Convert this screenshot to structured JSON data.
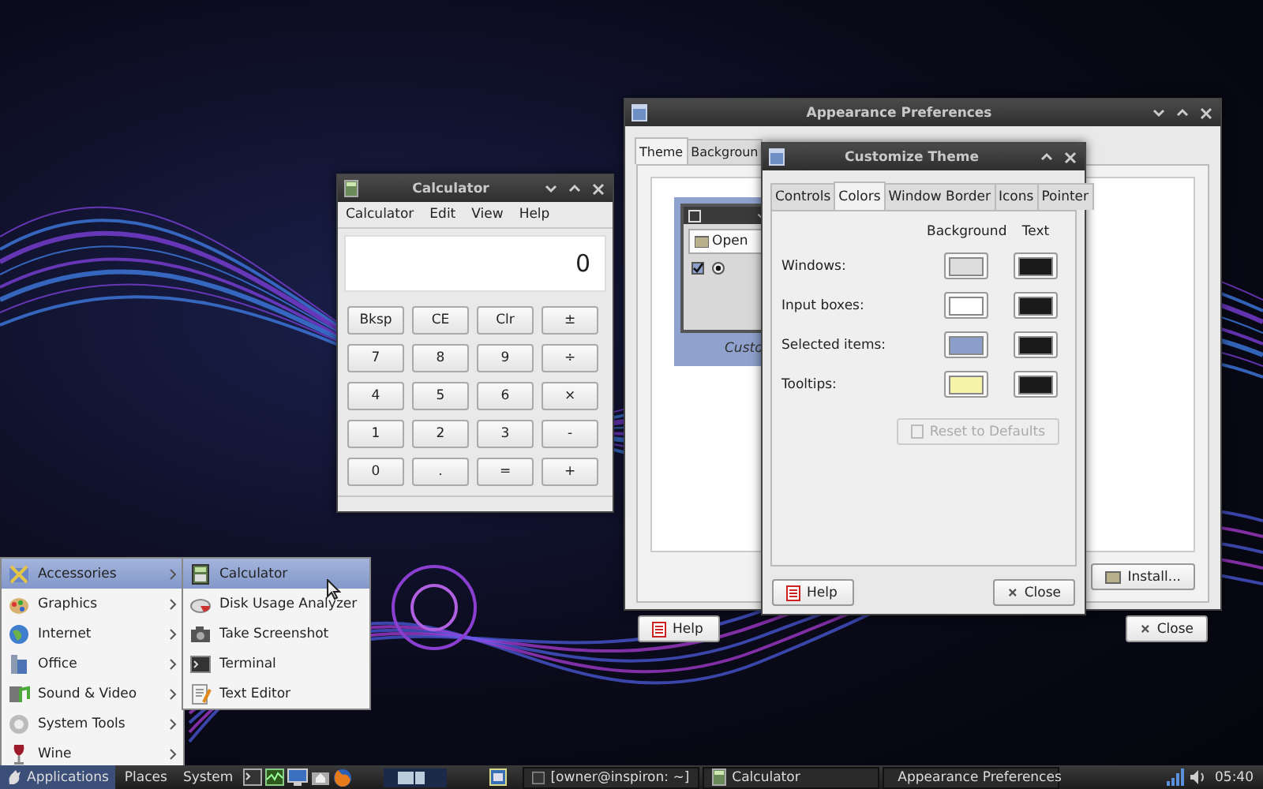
{
  "calculator": {
    "title": "Calculator",
    "menu": [
      "Calculator",
      "Edit",
      "View",
      "Help"
    ],
    "display": "0",
    "keys": [
      "Bksp",
      "CE",
      "Clr",
      "±",
      "7",
      "8",
      "9",
      "÷",
      "4",
      "5",
      "6",
      "×",
      "1",
      "2",
      "3",
      "-",
      "0",
      ".",
      "=",
      "+"
    ]
  },
  "appearance": {
    "title": "Appearance Preferences",
    "tabs": [
      {
        "label": "Theme",
        "selected": true
      },
      {
        "label": "Backgroun",
        "selected": false
      }
    ],
    "preview": {
      "button": "Open",
      "checked": true,
      "radio_selected": true,
      "caption": "Custo",
      "selected": true
    },
    "install_button": "Install...",
    "help_button": "Help",
    "close_button": "Close"
  },
  "customize": {
    "title": "Customize Theme",
    "tabs": [
      {
        "label": "Controls",
        "selected": false
      },
      {
        "label": "Colors",
        "selected": true
      },
      {
        "label": "Window Border",
        "selected": false
      },
      {
        "label": "Icons",
        "selected": false
      },
      {
        "label": "Pointer",
        "selected": false
      }
    ],
    "headers": [
      "Background",
      "Text"
    ],
    "rows": [
      {
        "label": "Windows:",
        "swatches": [
          {
            "color": "#dcdcdc"
          },
          {
            "color": "#1a1a1a"
          }
        ]
      },
      {
        "label": "Input boxes:",
        "swatches": [
          {
            "color": "#ffffff"
          },
          {
            "color": "#1a1a1a"
          }
        ]
      },
      {
        "label": "Selected items:",
        "swatches": [
          {
            "color": "#8c9ecc"
          },
          {
            "color": "#1a1a1a"
          }
        ]
      },
      {
        "label": "Tooltips:",
        "swatches": [
          {
            "color": "#f5f3a8"
          },
          {
            "color": "#1a1a1a"
          }
        ]
      }
    ],
    "reset_button": {
      "label": "Reset to Defaults",
      "disabled": true
    },
    "help_button": "Help",
    "close_button": "Close"
  },
  "app_menu": {
    "items": [
      {
        "label": "Accessories",
        "selected": true
      },
      {
        "label": "Graphics",
        "selected": false
      },
      {
        "label": "Internet",
        "selected": false
      },
      {
        "label": "Office",
        "selected": false
      },
      {
        "label": "Sound & Video",
        "selected": false
      },
      {
        "label": "System Tools",
        "selected": false
      },
      {
        "label": "Wine",
        "selected": false
      }
    ],
    "submenu": [
      {
        "label": "Calculator",
        "selected": true
      },
      {
        "label": "Disk Usage Analyzer",
        "selected": false
      },
      {
        "label": "Take Screenshot",
        "selected": false
      },
      {
        "label": "Terminal",
        "selected": false
      },
      {
        "label": "Text Editor",
        "selected": false
      }
    ]
  },
  "taskbar": {
    "menus": [
      {
        "label": "Applications",
        "selected": true
      },
      {
        "label": "Places",
        "selected": false
      },
      {
        "label": "System",
        "selected": false
      }
    ],
    "tasks": [
      {
        "label": "[owner@inspiron: ~]",
        "selected": false
      },
      {
        "label": "Calculator",
        "selected": false
      },
      {
        "label": "Appearance Preferences",
        "selected": false
      }
    ],
    "clock": "05:40"
  }
}
